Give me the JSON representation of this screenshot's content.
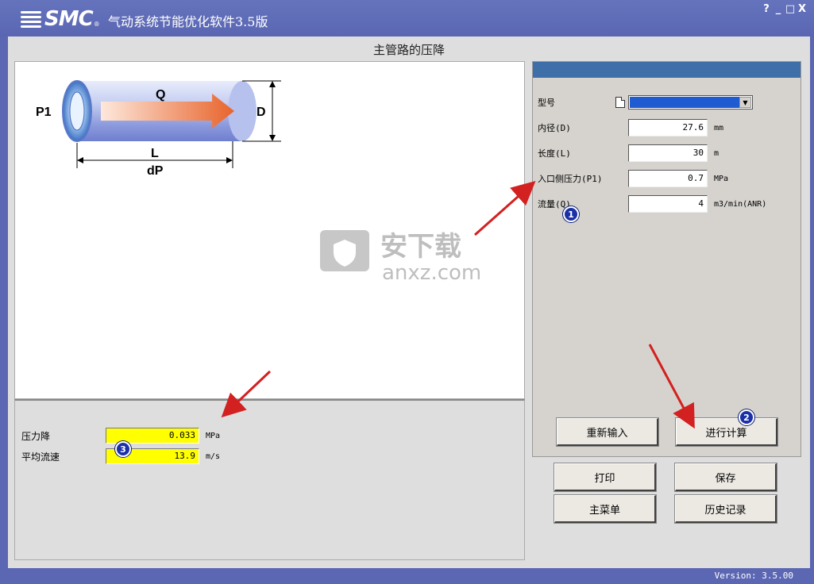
{
  "window": {
    "logo_text": "SMC",
    "logo_reg": "®",
    "title": "气动系统节能优化软件3.5版",
    "controls": [
      "?",
      "_",
      "□",
      "X"
    ]
  },
  "page": {
    "title": "主管路的压降"
  },
  "diagram": {
    "label_p1": "P1",
    "label_q": "Q",
    "label_d": "D",
    "label_l": "L",
    "label_dp": "dP"
  },
  "inputs": {
    "model": {
      "label": "型号",
      "value": ""
    },
    "diameter": {
      "label": "内径(D)",
      "value": "27.6",
      "unit": "mm"
    },
    "length": {
      "label": "长度(L)",
      "value": "30",
      "unit": "m"
    },
    "pressure": {
      "label": "入口侧压力(P1)",
      "value": "0.7",
      "unit": "MPa"
    },
    "flow": {
      "label": "流量(Q)",
      "value": "4",
      "unit": "m3/min(ANR)"
    }
  },
  "results": {
    "pressure_drop": {
      "label": "压力降",
      "value": "0.033",
      "unit": "MPa"
    },
    "avg_velocity": {
      "label": "平均流速",
      "value": "13.9",
      "unit": "m/s"
    }
  },
  "buttons": {
    "reset": "重新输入",
    "calculate": "进行计算",
    "print": "打印",
    "save": "保存",
    "main_menu": "主菜单",
    "history": "历史记录"
  },
  "badges": {
    "one": "1",
    "two": "2",
    "three": "3"
  },
  "watermark": {
    "cn": "安下载",
    "en": "anxz.com"
  },
  "status": {
    "version": "Version: 3.5.00"
  },
  "colors": {
    "titlebar": "#5b67b3",
    "panel_header": "#3e6fa8",
    "result_highlight": "#ffff00",
    "arrow": "#d32020",
    "badge": "#1a2fa8"
  }
}
